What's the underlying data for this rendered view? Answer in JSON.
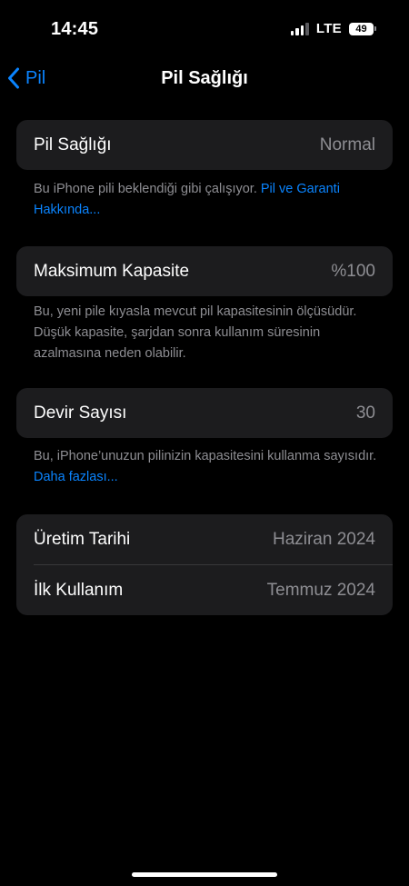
{
  "status_bar": {
    "time": "14:45",
    "network": "LTE",
    "battery_level": "49",
    "signal_bars_active": 3,
    "signal_bars_total": 4
  },
  "nav": {
    "back_label": "Pil",
    "title": "Pil Sağlığı"
  },
  "battery_health": {
    "label": "Pil Sağlığı",
    "value": "Normal",
    "footnote_text": "Bu iPhone pili beklendiği gibi çalışıyor. ",
    "footnote_link": "Pil ve Garanti Hakkında..."
  },
  "max_capacity": {
    "label": "Maksimum Kapasite",
    "value": "%100",
    "footnote_text": "Bu, yeni pile kıyasla mevcut pil kapasitesinin ölçüsüdür. Düşük kapasite, şarjdan sonra kullanım süresinin azalmasına neden olabilir."
  },
  "cycle_count": {
    "label": "Devir Sayısı",
    "value": "30",
    "footnote_text": "Bu, iPhone’unuzun pilinizin kapasitesini kullanma sayısıdır. ",
    "footnote_link": "Daha fazlası..."
  },
  "dates": {
    "manufacture_label": "Üretim Tarihi",
    "manufacture_value": "Haziran 2024",
    "first_use_label": "İlk Kullanım",
    "first_use_value": "Temmuz 2024"
  },
  "colors": {
    "background": "#000000",
    "card": "#1c1c1e",
    "accent": "#0a84ff",
    "secondary_text": "#8e8e93"
  }
}
